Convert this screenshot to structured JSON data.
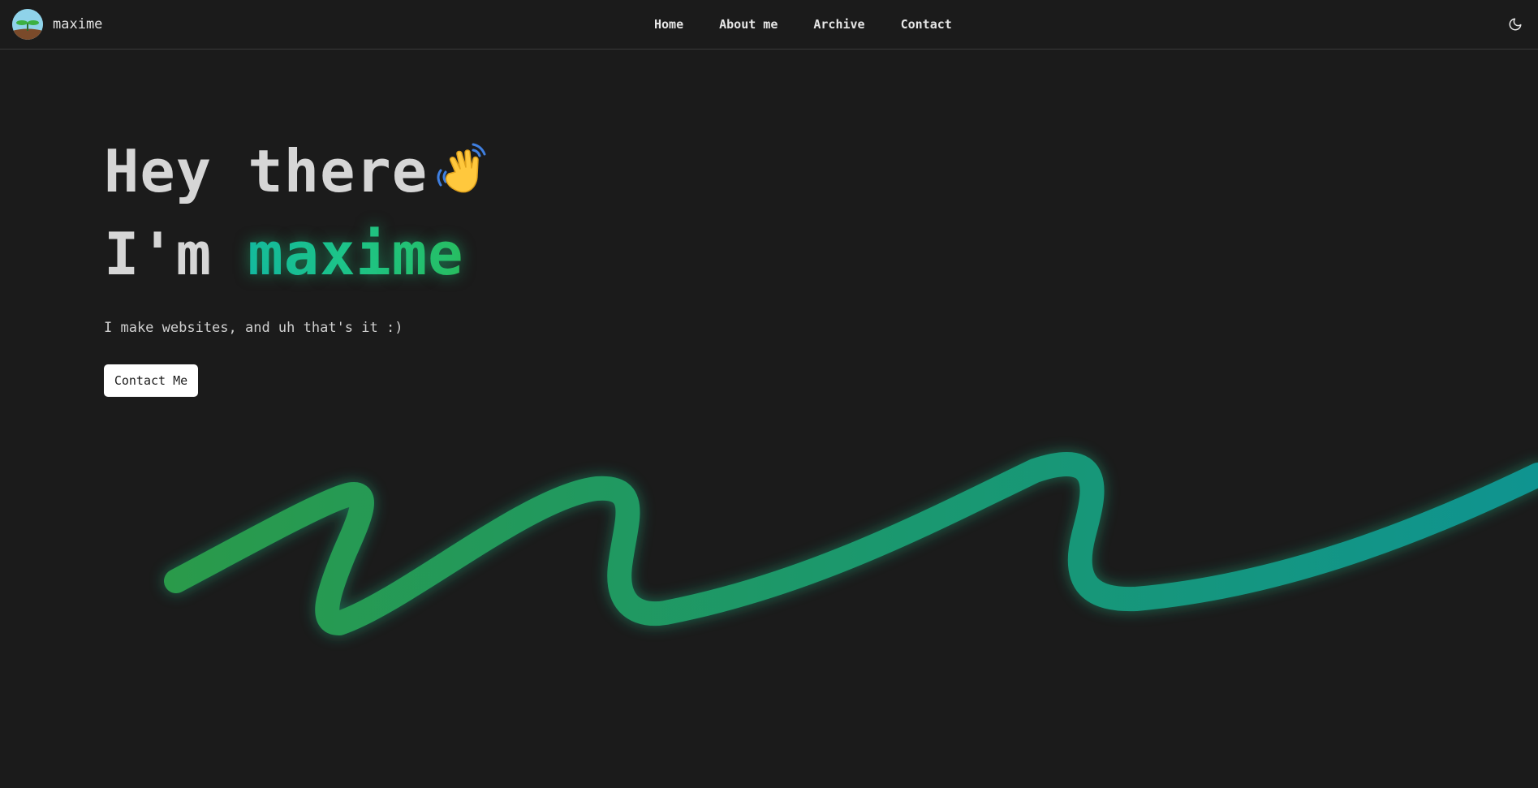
{
  "nav": {
    "brand_name": "maxime",
    "links": [
      {
        "label": "Home"
      },
      {
        "label": "About me"
      },
      {
        "label": "Archive"
      },
      {
        "label": "Contact"
      }
    ],
    "theme_toggle_icon": "moon-icon"
  },
  "hero": {
    "greeting": "Hey there",
    "wave_icon": "waving-hand-icon",
    "intro_prefix": "I'm ",
    "name": "maxime",
    "tagline": "I make websites, and uh that's it :)",
    "cta_label": "Contact Me"
  },
  "colors": {
    "background": "#1b1b1b",
    "accent_green": "#2a9a4a",
    "accent_teal": "#0f9490",
    "button_bg": "#ffffff"
  }
}
